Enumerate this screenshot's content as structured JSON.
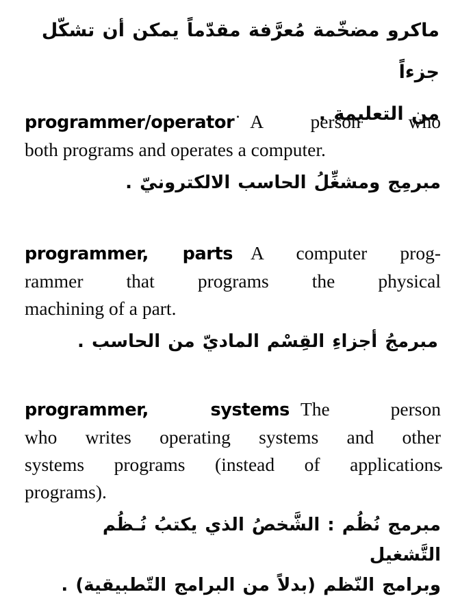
{
  "page": {
    "kind": "dictionary-page-scan",
    "language_pair": "English-Arabic",
    "background_color": "#ffffff",
    "text_color": "#0a0a0a"
  },
  "continuation": {
    "name": "previous-entry-arabic-continuation",
    "lines": [
      "ماكرو مضخّمة مُعرَّفة مقدّماً يمكن أن تشكّل جزءاً",
      "من التعليمة ."
    ]
  },
  "entries": [
    {
      "id": "programmer-operator",
      "headword": "programmer/operator",
      "definition_lines": [
        "A person who",
        "both programs and operates a computer."
      ],
      "definition_full": "A person who both programs and operates a computer.",
      "arabic_lines": [
        "مبرمِج ومشغِّلُ الحاسب الالكترونيّ ."
      ]
    },
    {
      "id": "programmer-parts",
      "headword": "programmer, parts",
      "definition_lines": [
        "A computer prog-",
        "rammer that programs the physical",
        "machining of a part."
      ],
      "definition_full": "A computer programmer that programs the physical machining of a part.",
      "arabic_lines": [
        "مبرمجُ أجزاءِ القِسْم الماديّ من الحاسب ."
      ]
    },
    {
      "id": "programmer-systems",
      "headword": "programmer, systems",
      "definition_lines": [
        "The person",
        "who writes operating systems and other",
        "systems programs (instead of applications",
        "programs)."
      ],
      "definition_full": "The person who writes operating systems and other systems programs (instead of applications programs).",
      "arabic_lines": [
        "مبرمج نُظُم : الشَّخصُ الذي يكتبُ نُـظُم التَّشغيل",
        "وبرامج النّظم (بدلاً من البرامج التّطبيقية) ."
      ]
    }
  ],
  "artifacts": {
    "headword_trailing_speck": "·",
    "margin_speck": "·"
  }
}
